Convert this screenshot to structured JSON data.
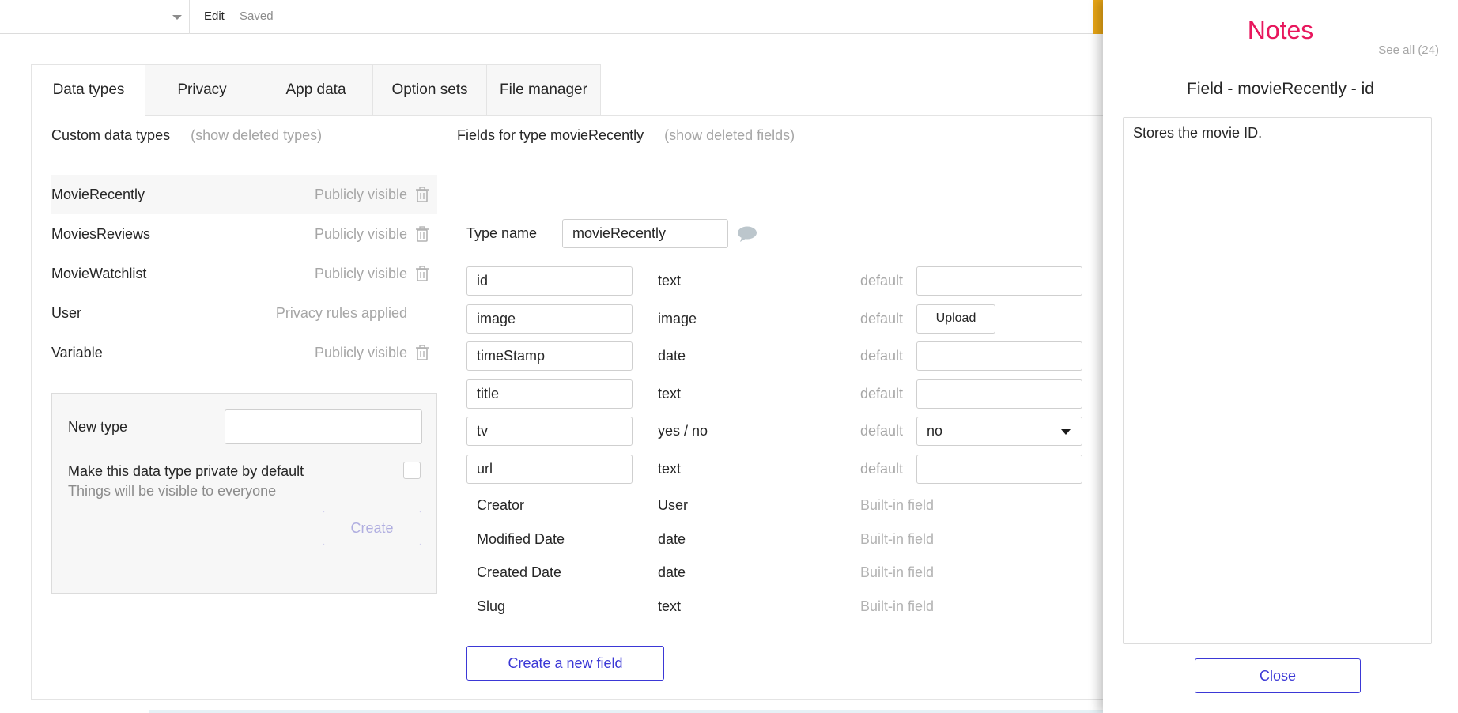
{
  "topbar": {
    "edit_label": "Edit",
    "saved_label": "Saved"
  },
  "tabs": [
    {
      "label": "Data types",
      "active": true
    },
    {
      "label": "Privacy",
      "active": false
    },
    {
      "label": "App data",
      "active": false
    },
    {
      "label": "Option sets",
      "active": false
    },
    {
      "label": "File manager",
      "active": false
    }
  ],
  "left": {
    "header": "Custom data types",
    "show_deleted": "(show deleted types)",
    "types": [
      {
        "name": "MovieRecently",
        "visibility": "Publicly visible",
        "trash": true
      },
      {
        "name": "MoviesReviews",
        "visibility": "Publicly visible",
        "trash": true
      },
      {
        "name": "MovieWatchlist",
        "visibility": "Publicly visible",
        "trash": true
      },
      {
        "name": "User",
        "visibility": "Privacy rules applied",
        "trash": false
      },
      {
        "name": "Variable",
        "visibility": "Publicly visible",
        "trash": true
      }
    ],
    "new_type": {
      "label": "New type",
      "input_value": "",
      "private_label": "Make this data type private by default",
      "private_sub": "Things will be visible to everyone",
      "create_label": "Create"
    }
  },
  "right": {
    "header": "Fields for type movieRecently",
    "show_deleted": "(show deleted fields)",
    "type_name_label": "Type name",
    "type_name_value": "movieRecently",
    "default_label": "default",
    "fields": [
      {
        "name": "id",
        "type": "text",
        "control": "input",
        "value": ""
      },
      {
        "name": "image",
        "type": "image",
        "control": "upload",
        "value": "Upload"
      },
      {
        "name": "timeStamp",
        "type": "date",
        "control": "input",
        "value": ""
      },
      {
        "name": "title",
        "type": "text",
        "control": "input",
        "value": ""
      },
      {
        "name": "tv",
        "type": "yes / no",
        "control": "select",
        "value": "no"
      },
      {
        "name": "url",
        "type": "text",
        "control": "input",
        "value": ""
      }
    ],
    "builtin_label": "Built-in field",
    "builtins": [
      {
        "name": "Creator",
        "type": "User"
      },
      {
        "name": "Modified Date",
        "type": "date"
      },
      {
        "name": "Created Date",
        "type": "date"
      },
      {
        "name": "Slug",
        "type": "text"
      }
    ],
    "create_field_label": "Create a new field"
  },
  "notes": {
    "title": "Notes",
    "see_all": "See all (24)",
    "field_title": "Field - movieRecently - id",
    "text": "Stores the movie ID.",
    "close_label": "Close"
  },
  "colors": {
    "accent": "#3b38d6",
    "notes_title": "#e8175d",
    "muted": "#a6a6a6"
  }
}
